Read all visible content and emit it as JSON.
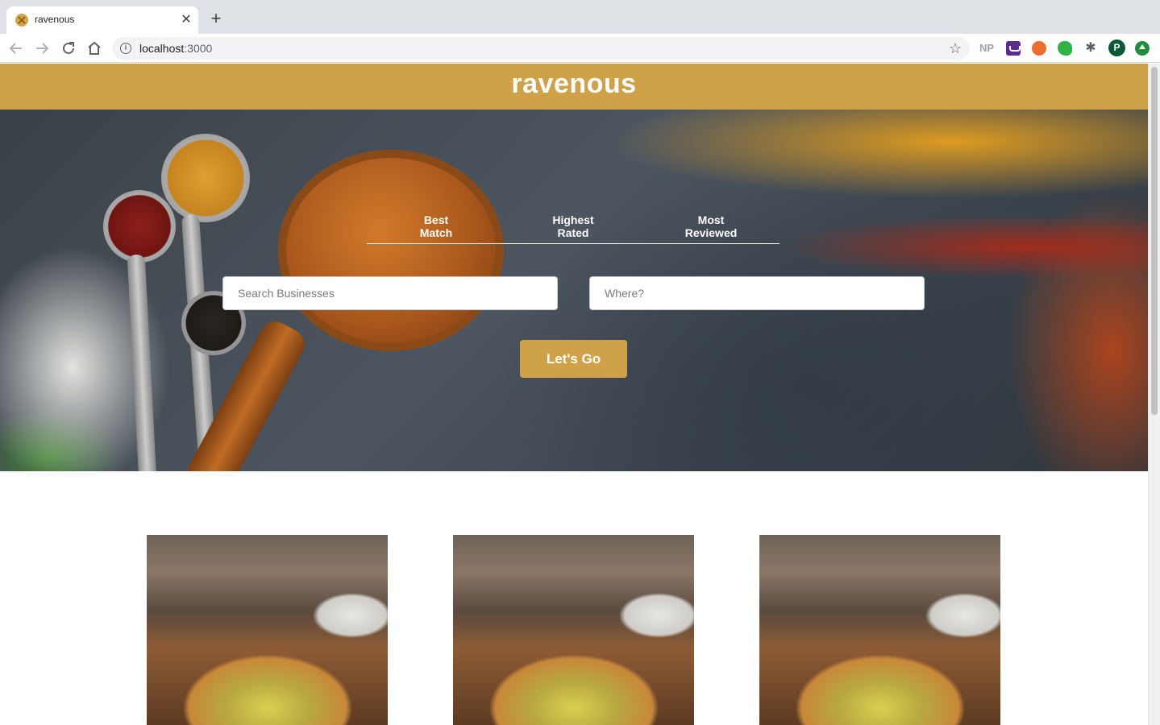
{
  "browser": {
    "tab_title": "ravenous",
    "url_host": "localhost",
    "url_port": ":3000",
    "avatar_initial": "P",
    "np_extension_label": "NP",
    "icons": [
      "back-icon",
      "forward-icon",
      "reload-icon",
      "home-icon",
      "info-icon",
      "star-icon",
      "puzzle-icon"
    ]
  },
  "header": {
    "logo": "ravenous",
    "color": "#cfa24a"
  },
  "search": {
    "sort_options": [
      {
        "line1": "Best",
        "line2": "Match"
      },
      {
        "line1": "Highest",
        "line2": "Rated"
      },
      {
        "line1": "Most",
        "line2": "Reviewed"
      }
    ],
    "term_placeholder": "Search Businesses",
    "location_placeholder": "Where?",
    "submit_label": "Let's Go"
  },
  "business_list": {
    "count_visible": 3,
    "image_subject": "pizza"
  }
}
